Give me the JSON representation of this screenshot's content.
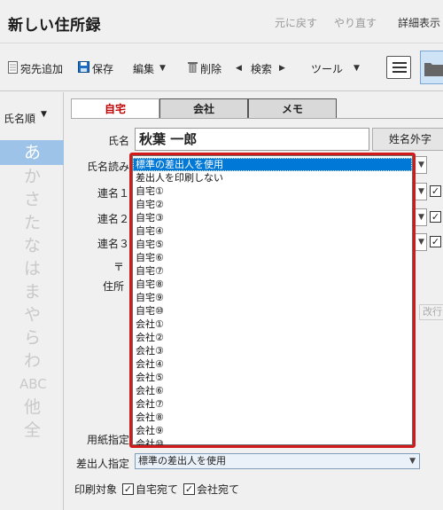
{
  "window": {
    "title": "新しい住所録",
    "undo": "元に戻す",
    "redo": "やり直す",
    "details": "詳細表示"
  },
  "toolbar": {
    "add_recipient": "宛先追加",
    "save": "保存",
    "edit": "編集",
    "delete": "削除",
    "search": "検索",
    "tools": "ツール"
  },
  "index": {
    "sort_label": "氏名順",
    "kana": [
      "あ",
      "か",
      "さ",
      "た",
      "な",
      "は",
      "ま",
      "や",
      "ら",
      "わ",
      "ABC",
      "他",
      "全"
    ],
    "selected": "あ"
  },
  "tabs": [
    "自宅",
    "会社",
    "メモ"
  ],
  "form": {
    "name_label": "氏名",
    "name_value": "秋葉 一郎",
    "gaiji_button": "姓名外字",
    "reading_label": "氏名読み",
    "joint1_label": "連名１",
    "joint2_label": "連名２",
    "joint3_label": "連名３",
    "postal_label": "〒",
    "address_label": "住所",
    "newline_button": "改行",
    "paper_label": "用紙指定",
    "sender_label": "差出人指定",
    "sender_value": "標準の差出人を使用",
    "print_target_label": "印刷対象",
    "print_home": "自宅宛て",
    "print_company": "会社宛て"
  },
  "dropdown": {
    "options": [
      "標準の差出人を使用",
      "差出人を印刷しない",
      "自宅①",
      "自宅②",
      "自宅③",
      "自宅④",
      "自宅⑤",
      "自宅⑥",
      "自宅⑦",
      "自宅⑧",
      "自宅⑨",
      "自宅⑩",
      "会社①",
      "会社②",
      "会社③",
      "会社④",
      "会社⑤",
      "会社⑥",
      "会社⑦",
      "会社⑧",
      "会社⑨",
      "会社⑩"
    ],
    "selected_index": 0
  },
  "colors": {
    "accent_red": "#c00000",
    "highlight_blue": "#0078d7",
    "index_selected": "#9dc3e8",
    "dropdown_border": "#d11a1a"
  }
}
